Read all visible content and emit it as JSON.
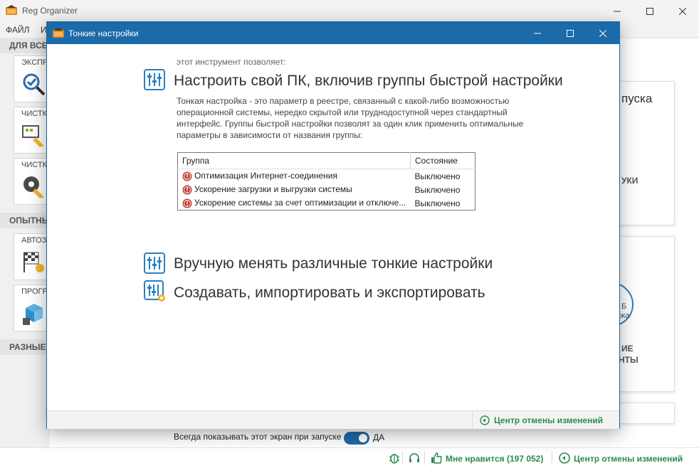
{
  "main_window": {
    "title": "Reg Organizer",
    "menu": [
      "ФАЙЛ",
      "И"
    ],
    "sections": [
      "ДЛЯ ВСЕХ",
      "ОПЫТНЫМ",
      "РАЗНЫЕ В"
    ],
    "tools": [
      "ЭКСПРЕ",
      "ЧИСТК",
      "ЧИСТК",
      "АВТОЗ",
      "ПРОГР"
    ],
    "right_cards": {
      "card1_lines": [
        "пуска",
        "УКИ"
      ],
      "card2_lines": [
        "Б",
        "жа",
        "ИЕ",
        "НТЫ"
      ]
    },
    "always_show_label": "Всегда показывать этот экран при запуске",
    "toggle_label": "ДА",
    "toggle_on": true,
    "status_bar": {
      "like_label": "Мне нравится (197 052)",
      "undo_center_label": "Центр отмены изменений"
    }
  },
  "dialog": {
    "title": "Тонкие настройки",
    "intro": "этот инструмент позволяет:",
    "feature_main": "Настроить свой ПК, включив группы быстрой настройки",
    "description": "Тонкая настройка - это параметр в реестре, связанный с какой-либо возможностью операционной системы, нередко скрытой или труднодоступной через стандартный интерфейс. Группы быстрой настройки позволят за один клик применить оптимальные параметры в зависимости от названия группы:",
    "table": {
      "headers": [
        "Группа",
        "Состояние"
      ],
      "rows": [
        {
          "group": "Оптимизация Интернет-соединения",
          "state": "Выключено"
        },
        {
          "group": "Ускорение загрузки и выгрузки системы",
          "state": "Выключено"
        },
        {
          "group": "Ускорение системы за счет оптимизации и отключе...",
          "state": "Выключено"
        }
      ]
    },
    "feature_manual": "Вручную менять различные тонкие настройки",
    "feature_create": "Создавать, импортировать и экспортировать",
    "footer_undo_label": "Центр отмены изменений"
  },
  "colors": {
    "accent_blue": "#1b6aaa",
    "green_text": "#2c8a4f",
    "error_red": "#c0392b"
  }
}
